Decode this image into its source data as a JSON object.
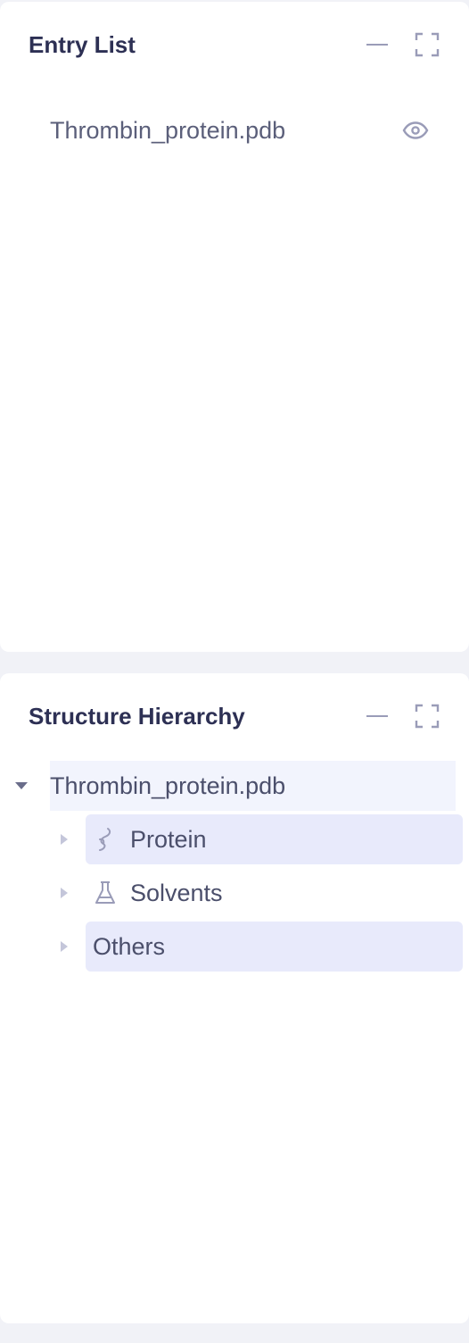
{
  "entry_list": {
    "title": "Entry List",
    "entries": [
      {
        "name": "Thrombin_protein.pdb",
        "visible": true
      }
    ]
  },
  "structure_hierarchy": {
    "title": "Structure Hierarchy",
    "root": {
      "label": "Thrombin_protein.pdb",
      "expanded": true,
      "children": [
        {
          "label": "Protein",
          "icon": "protein-icon",
          "expanded": false
        },
        {
          "label": "Solvents",
          "icon": "flask-icon",
          "expanded": false
        },
        {
          "label": "Others",
          "expanded": false
        }
      ]
    }
  },
  "colors": {
    "background": "#f1f2f7",
    "panel": "#ffffff",
    "title_text": "#2d3054",
    "body_text": "#5b5f7a",
    "icon": "#9a9cb8",
    "selected_row": "#e8eafb",
    "root_row": "#f2f4fd"
  }
}
